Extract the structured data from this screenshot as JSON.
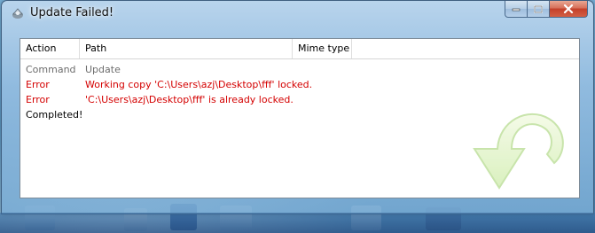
{
  "window": {
    "title": "Update Failed!"
  },
  "table": {
    "columns": [
      "Action",
      "Path",
      "Mime type"
    ],
    "rows": [
      {
        "action": "Command",
        "path": "Update",
        "color": "#6d6d6d"
      },
      {
        "action": "Error",
        "path": "Working copy 'C:\\Users\\azj\\Desktop\\fff' locked.",
        "color": "#d40000"
      },
      {
        "action": "Error",
        "path": "'C:\\Users\\azj\\Desktop\\fff' is already locked.",
        "color": "#d40000"
      },
      {
        "action": "Completed!",
        "path": "",
        "color": "#000000"
      }
    ]
  },
  "icons": {
    "app": "tortoisesvn-update-icon",
    "status": "update-arrow-icon"
  }
}
